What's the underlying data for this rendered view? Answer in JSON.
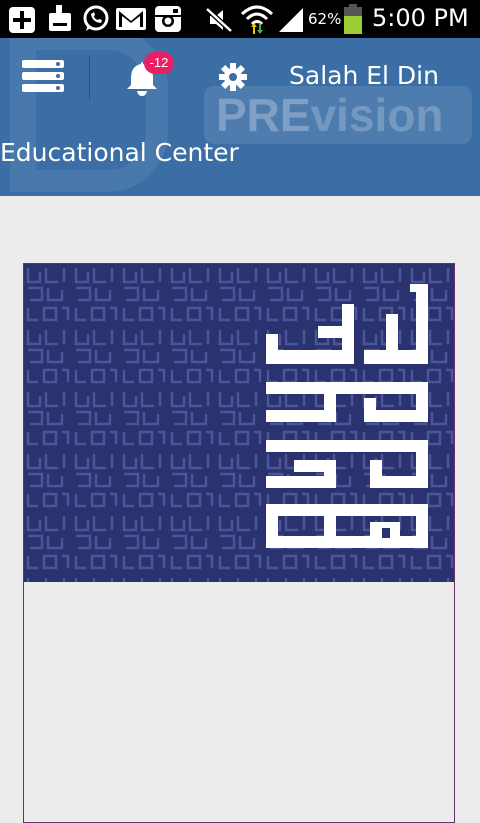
{
  "status_bar": {
    "battery_percent": "62%",
    "time": "5:00 PM",
    "icons": [
      "add-icon",
      "cleaner-icon",
      "whatsapp-icon",
      "gmail-icon",
      "instagram-icon",
      "mute-icon",
      "wifi-icon",
      "signal-icon",
      "battery-icon"
    ]
  },
  "header": {
    "notification_count": "-12",
    "user_name": "Salah El Din",
    "subtitle": "Educational Center",
    "logo_watermark": "PREvision",
    "background_color": "#3a6ea5"
  },
  "banner": {
    "image": "arabic-calligraphy-banner",
    "background_color": "#2a3270"
  },
  "colors": {
    "status_bar": "#000000",
    "badge": "#e91e63",
    "card_border": "#6b2f6e",
    "page_background": "#ececec"
  }
}
